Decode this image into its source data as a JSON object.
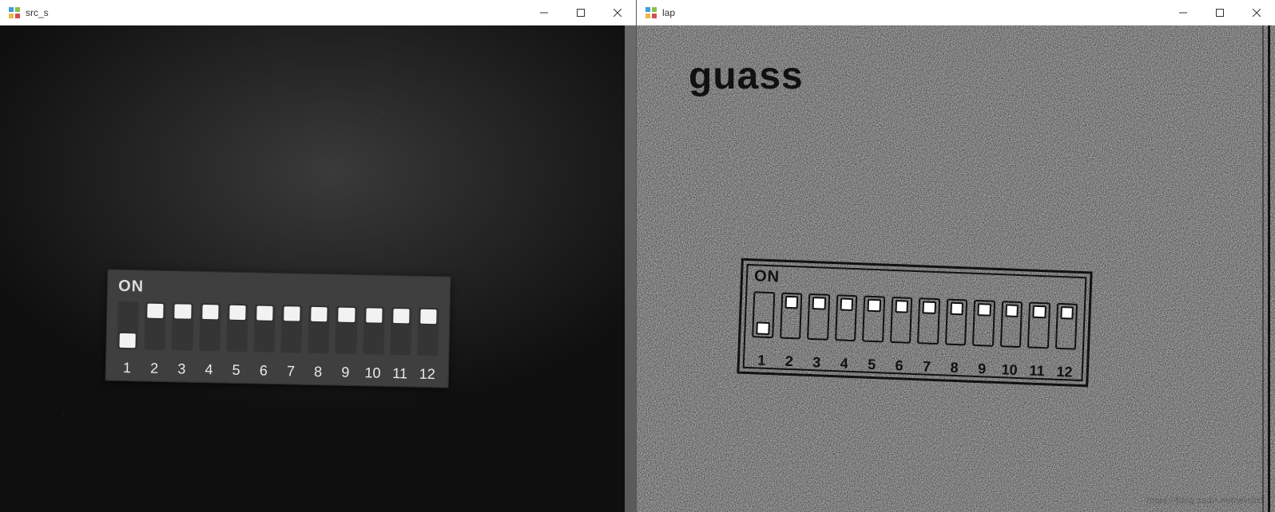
{
  "windows": {
    "left": {
      "title": "src_s"
    },
    "right": {
      "title": "lap"
    }
  },
  "overlay": {
    "right_label": "guass"
  },
  "dip": {
    "on_label": "ON",
    "positions": [
      "down",
      "up",
      "up",
      "up",
      "up",
      "up",
      "up",
      "up",
      "up",
      "up",
      "up",
      "up"
    ],
    "numbers": [
      "1",
      "2",
      "3",
      "4",
      "5",
      "6",
      "7",
      "8",
      "9",
      "10",
      "11",
      "12"
    ]
  },
  "watermark": "https://blog.csdn.net/windxf"
}
